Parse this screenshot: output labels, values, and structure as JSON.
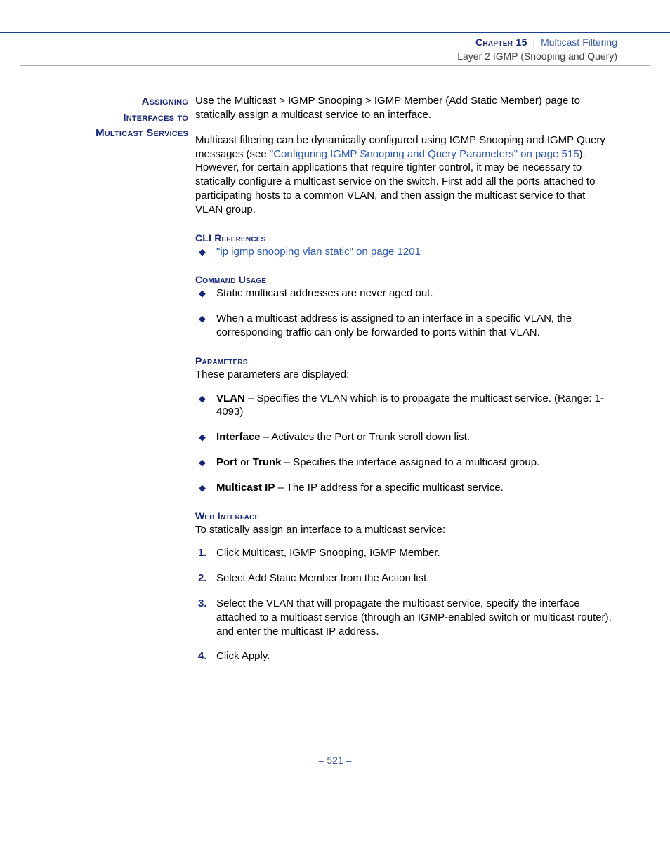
{
  "header": {
    "chapter_label": "Chapter 15",
    "separator": "|",
    "chapter_topic": "Multicast Filtering",
    "sub": "Layer 2 IGMP (Snooping and Query)"
  },
  "side_title": {
    "l1": "Assigning",
    "l2": "Interfaces to",
    "l3": "Multicast Services"
  },
  "intro1_a": "Use the Multicast > IGMP Snooping > IGMP Member (Add Static Member) page to statically assign a multicast service to an interface.",
  "intro2_a": "Multicast filtering can be dynamically configured using IGMP Snooping and IGMP Query messages (see ",
  "intro2_link": "\"Configuring IGMP Snooping and Query Parameters\" on page 515",
  "intro2_b": "). However, for certain applications that require tighter control, it may be necessary to statically configure a multicast service on the switch. First add all the ports attached to participating hosts to a common VLAN, and then assign the multicast service to that VLAN group.",
  "headings": {
    "cli": "CLI References",
    "usage": "Command Usage",
    "params": "Parameters",
    "web": "Web Interface"
  },
  "cli_link": "\"ip igmp snooping vlan static\" on page 1201",
  "usage": {
    "u1": "Static multicast addresses are never aged out.",
    "u2": "When a multicast address is assigned to an interface in a specific VLAN, the corresponding traffic can only be forwarded to ports within that VLAN."
  },
  "params_intro": "These parameters are displayed:",
  "params": {
    "p1_b": "VLAN",
    "p1_t": " – Specifies the VLAN which is to propagate the multicast service. (Range: 1-4093)",
    "p2_b": "Interface",
    "p2_t": " – Activates the Port or Trunk scroll down list.",
    "p3_b1": "Port",
    "p3_mid": " or ",
    "p3_b2": "Trunk",
    "p3_t": " – Specifies the interface assigned to a multicast group.",
    "p4_b": "Multicast IP",
    "p4_t": " – The IP address for a specific multicast service."
  },
  "web_intro": "To statically assign an interface to a multicast service:",
  "steps": {
    "s1": "Click Multicast, IGMP Snooping, IGMP Member.",
    "s2": "Select Add Static Member from the Action list.",
    "s3": "Select the VLAN that will propagate the multicast service, specify the interface attached to a multicast service (through an IGMP-enabled switch or multicast router), and enter the multicast IP address.",
    "s4": "Click Apply."
  },
  "footer": "–  521  –"
}
